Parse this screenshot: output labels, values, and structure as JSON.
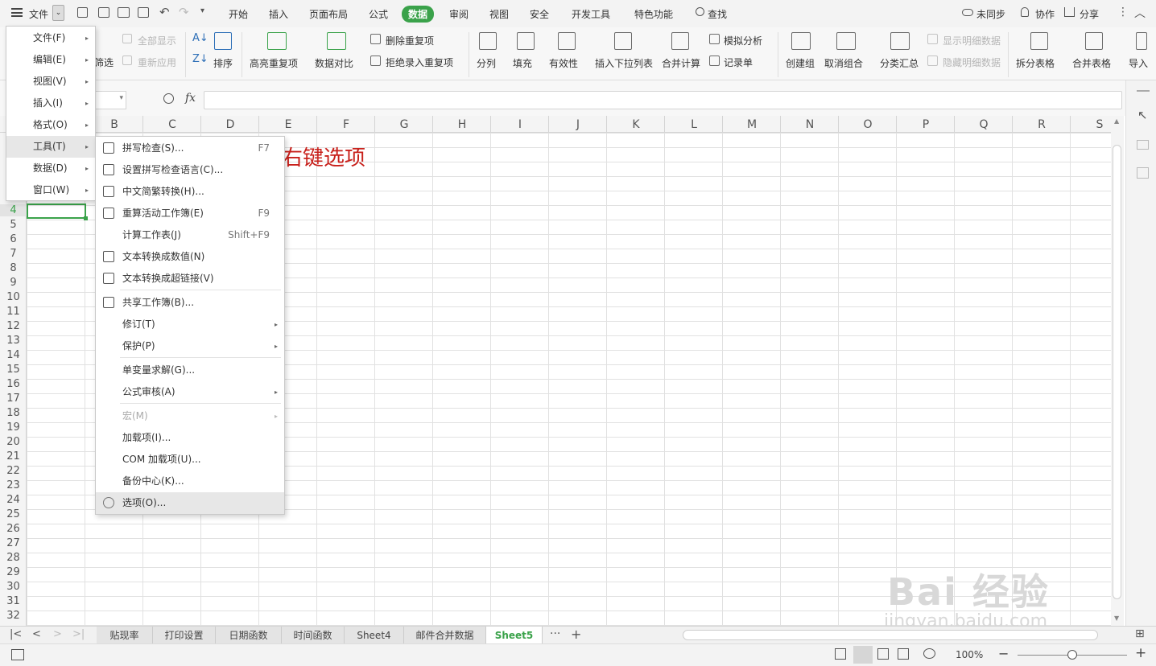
{
  "menubar": {
    "file": "文件",
    "tabs": [
      "开始",
      "插入",
      "页面布局",
      "公式",
      "数据",
      "审阅",
      "视图",
      "安全",
      "开发工具",
      "特色功能"
    ],
    "search": "查找",
    "sync": "未同步",
    "collab": "协作",
    "share": "分享"
  },
  "ribbon": {
    "show_all": "全部显示",
    "filter": "筛选",
    "reapply": "重新应用",
    "sort": "排序",
    "highlight_dup": "高亮重复项",
    "data_compare": "数据对比",
    "remove_dup": "删除重复项",
    "reject_dup": "拒绝录入重复项",
    "split": "分列",
    "fill": "填充",
    "validity": "有效性",
    "insert_dropdown": "插入下拉列表",
    "consolidate": "合并计算",
    "simulate": "模拟分析",
    "record": "记录单",
    "group": "创建组",
    "ungroup": "取消组合",
    "subtotal": "分类汇总",
    "show_detail": "显示明细数据",
    "hide_detail": "隐藏明细数据",
    "split_table": "拆分表格",
    "merge_table": "合并表格",
    "import": "导入"
  },
  "formula": {
    "fx": "fx",
    "value": ""
  },
  "columns": [
    "B",
    "C",
    "D",
    "E",
    "F",
    "G",
    "H",
    "I",
    "J",
    "K",
    "L",
    "M",
    "N",
    "O",
    "P",
    "Q",
    "R",
    "S"
  ],
  "rows": [
    "4",
    "5",
    "6",
    "7",
    "8",
    "9",
    "10",
    "11",
    "12",
    "13",
    "14",
    "15",
    "16",
    "17",
    "18",
    "19",
    "20",
    "21",
    "22",
    "23",
    "24",
    "25",
    "26",
    "27",
    "28",
    "29",
    "30",
    "31",
    "32"
  ],
  "cell_text": "右键选项",
  "file_menu": {
    "items": [
      {
        "label": "文件(F)"
      },
      {
        "label": "编辑(E)"
      },
      {
        "label": "视图(V)"
      },
      {
        "label": "插入(I)"
      },
      {
        "label": "格式(O)"
      },
      {
        "label": "工具(T)"
      },
      {
        "label": "数据(D)"
      },
      {
        "label": "窗口(W)"
      }
    ]
  },
  "tools_menu": {
    "items": [
      {
        "label": "拼写检查(S)...",
        "shortcut": "F7",
        "icon": "spellcheck-icon"
      },
      {
        "label": "设置拼写检查语言(C)...",
        "shortcut": "",
        "icon": "language-icon"
      },
      {
        "label": "中文简繁转换(H)...",
        "shortcut": "",
        "icon": "convert-icon"
      },
      {
        "label": "重算活动工作簿(E)",
        "shortcut": "F9",
        "icon": "recalc-icon"
      },
      {
        "label": "计算工作表(J)",
        "shortcut": "Shift+F9",
        "icon": ""
      },
      {
        "label": "文本转换成数值(N)",
        "shortcut": "",
        "icon": "text-number-icon"
      },
      {
        "label": "文本转换成超链接(V)",
        "shortcut": "",
        "icon": "hyperlink-icon"
      },
      {
        "label": "共享工作簿(B)...",
        "shortcut": "",
        "icon": "share-workbook-icon"
      },
      {
        "label": "修订(T)",
        "shortcut": "",
        "icon": ""
      },
      {
        "label": "保护(P)",
        "shortcut": "",
        "icon": ""
      },
      {
        "label": "单变量求解(G)...",
        "shortcut": "",
        "icon": ""
      },
      {
        "label": "公式审核(A)",
        "shortcut": "",
        "icon": ""
      },
      {
        "label": "宏(M)",
        "shortcut": "",
        "icon": ""
      },
      {
        "label": "加载项(I)...",
        "shortcut": "",
        "icon": ""
      },
      {
        "label": "COM 加载项(U)...",
        "shortcut": "",
        "icon": ""
      },
      {
        "label": "备份中心(K)...",
        "shortcut": "",
        "icon": ""
      },
      {
        "label": "选项(O)...",
        "shortcut": "",
        "icon": "gear-icon"
      }
    ]
  },
  "sheets": [
    "贴现率",
    "打印设置",
    "日期函数",
    "时间函数",
    "Sheet4",
    "邮件合并数据",
    "Sheet5"
  ],
  "status": {
    "zoom": "100%"
  },
  "watermark": {
    "line1": "Bai 经验",
    "line2": "jingyan.baidu.com"
  },
  "colors": {
    "accent": "#3aa24a",
    "cell_text": "#c8201b"
  }
}
